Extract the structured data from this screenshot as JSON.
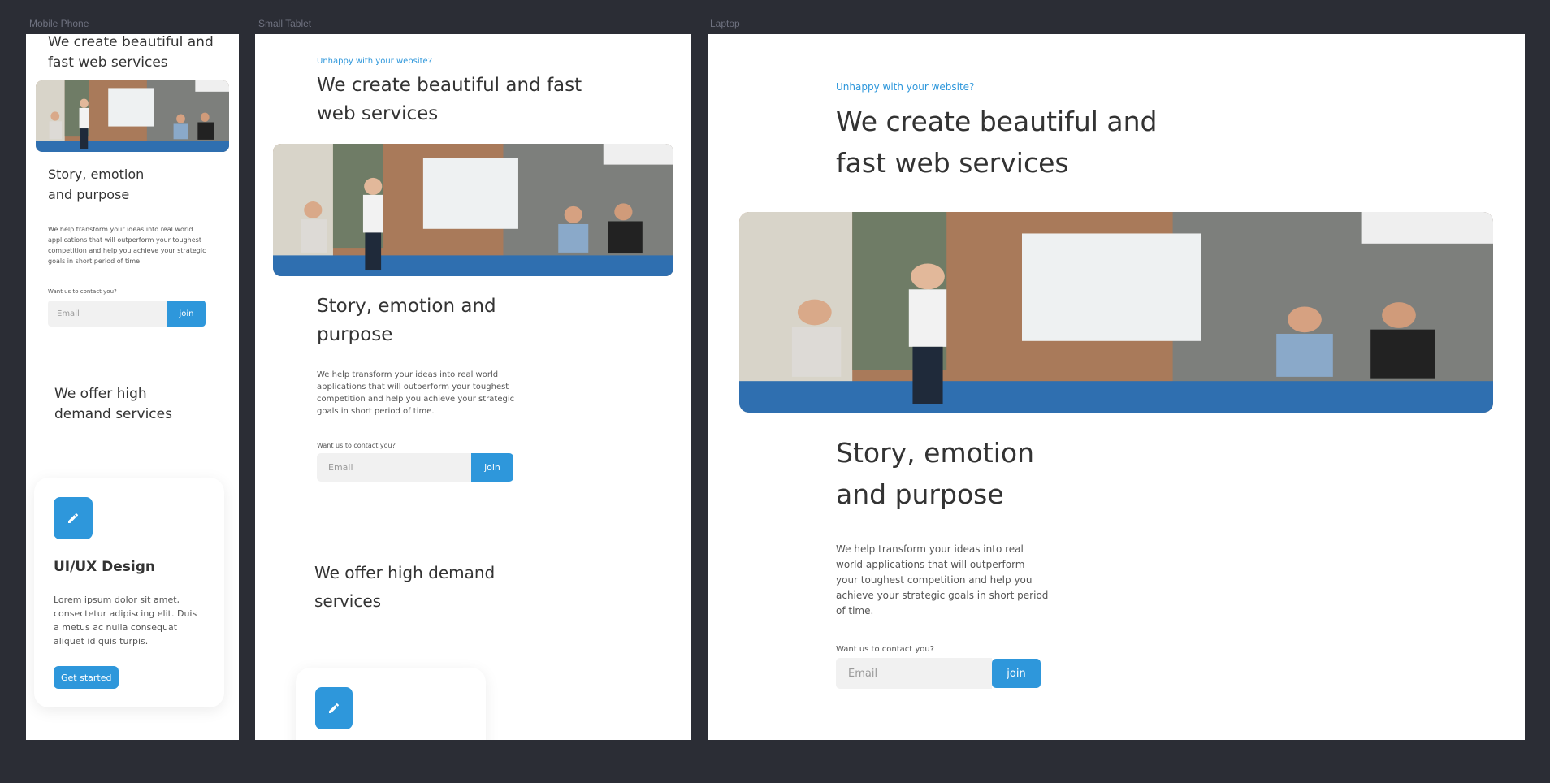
{
  "frames": {
    "mobile": {
      "label": "Mobile Phone"
    },
    "tablet": {
      "label": "Small Tablet"
    },
    "laptop": {
      "label": "Laptop"
    }
  },
  "content": {
    "eyebrow": "Unhappy with your website?",
    "headline": "We create beautiful and fast web services",
    "story_title": "Story, emotion and purpose",
    "story_body": "We help transform your ideas into real world applications that will outperform your toughest competition and help you achieve your strategic goals in short period of time.",
    "contact_label": "Want us to contact you?",
    "email_placeholder": "Email",
    "join_label": "join",
    "services_title": "We offer high demand services",
    "card": {
      "title": "UI/UX Design",
      "body": "Lorem ipsum dolor sit amet, consectetur adipiscing elit. Duis a metus ac nulla consequat aliquet id quis turpis.",
      "cta": "Get started",
      "icon": "pencil-icon"
    }
  },
  "colors": {
    "accent": "#2e97db",
    "background": "#2b2d35",
    "text": "#333333"
  }
}
